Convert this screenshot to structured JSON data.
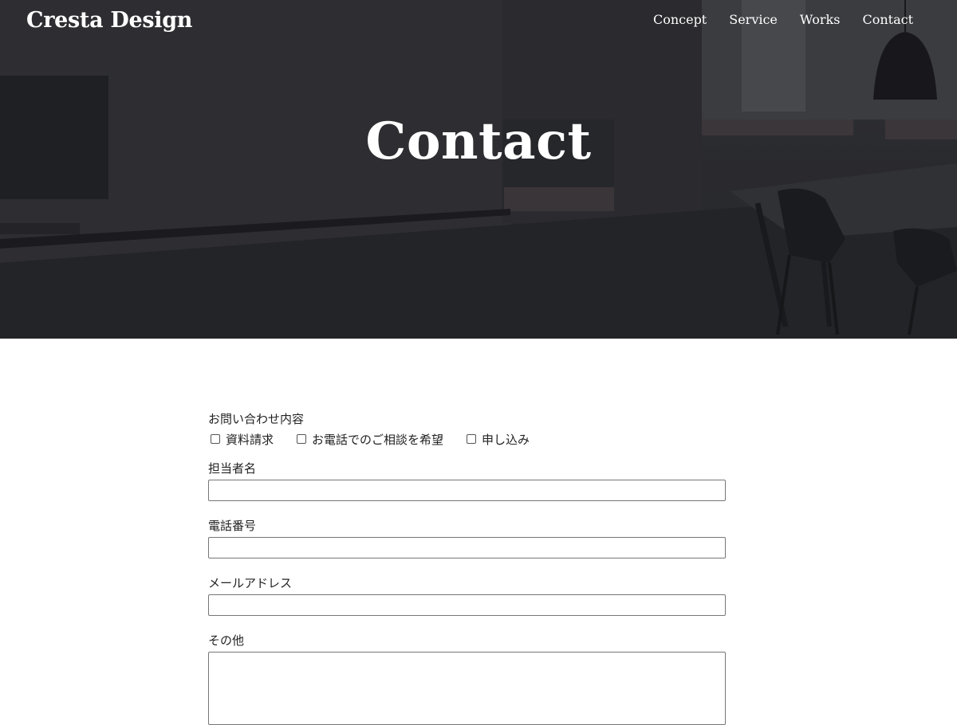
{
  "header": {
    "logo": "Cresta Design",
    "nav": [
      "Concept",
      "Service",
      "Works",
      "Contact"
    ]
  },
  "hero": {
    "title": "Contact"
  },
  "form": {
    "inquiry_label": "お問い合わせ内容",
    "options": [
      "資料請求",
      "お電話でのご相談を希望",
      "申し込み"
    ],
    "name_label": "担当者名",
    "phone_label": "電話番号",
    "email_label": "メールアドレス",
    "other_label": "その他"
  }
}
